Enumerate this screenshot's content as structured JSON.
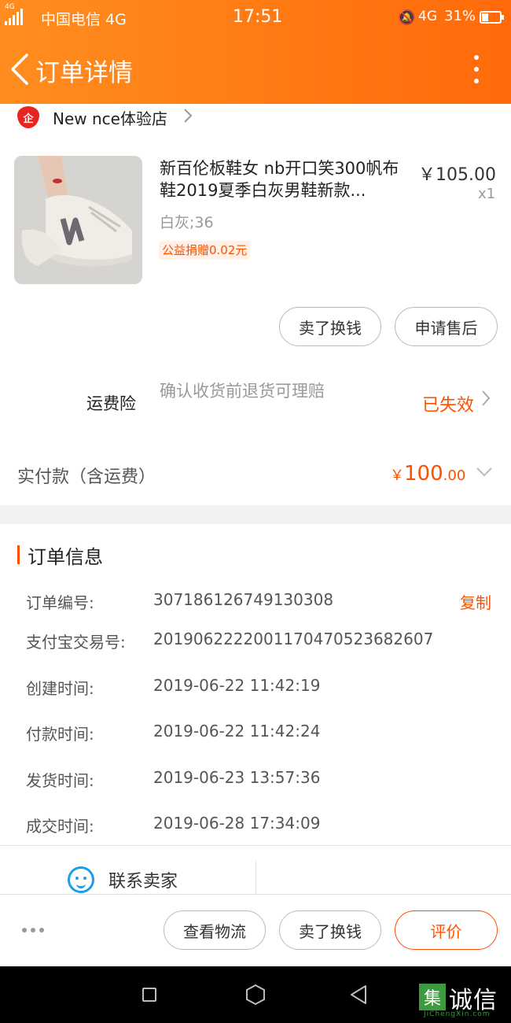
{
  "status_bar": {
    "network_tag": "4G",
    "carrier": "中国电信 4G",
    "time": "17:51",
    "network": "4G",
    "battery": "31%"
  },
  "nav": {
    "title": "订单详情"
  },
  "shop": {
    "badge": "企",
    "name": "New nce体验店"
  },
  "product": {
    "title": "新百伦板鞋女 nb开口笑300帆布鞋2019夏季白灰男鞋新款...",
    "price": "￥105.00",
    "qty": "x1",
    "sku": "白灰;36",
    "charity": "公益捐赠0.02元",
    "actions": [
      "卖了换钱",
      "申请售后"
    ]
  },
  "insurance": {
    "label": "运费险",
    "desc": "确认收货前退货可理赔",
    "status": "已失效"
  },
  "payment": {
    "label": "实付款（含运费）",
    "currency": "￥",
    "amount_int": "100",
    "amount_dec": ".00"
  },
  "order_info": {
    "heading": "订单信息",
    "copy_label": "复制",
    "rows": [
      {
        "label": "订单编号:",
        "value": "307186126749130308"
      },
      {
        "label": "支付宝交易号:",
        "value": "2019062222001170470523682607"
      },
      {
        "label": "创建时间:",
        "value": "2019-06-22 11:42:19"
      },
      {
        "label": "付款时间:",
        "value": "2019-06-22 11:42:24"
      },
      {
        "label": "发货时间:",
        "value": "2019-06-23 13:57:36"
      },
      {
        "label": "成交时间:",
        "value": "2019-06-28 17:34:09"
      }
    ],
    "contact_label": "联系卖家"
  },
  "bottom_bar": {
    "buttons": [
      "查看物流",
      "卖了换钱",
      "评价"
    ]
  },
  "watermark": {
    "box": "集",
    "text": "诚信",
    "sub": "JiChengXin.com"
  },
  "colors": {
    "accent": "#ff5000",
    "header_start": "#ff8d1f",
    "header_end": "#ff6a0a",
    "contact_icon": "#1c9ee8"
  }
}
